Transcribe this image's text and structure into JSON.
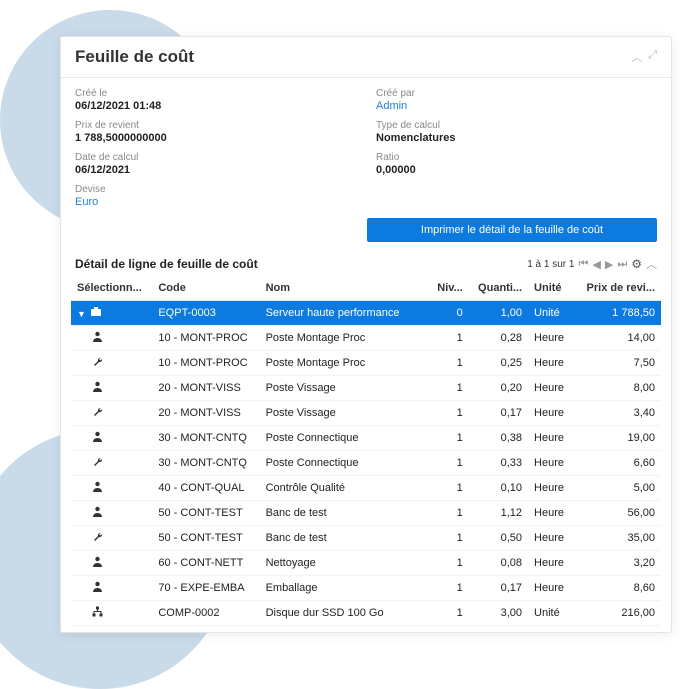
{
  "panel": {
    "title": "Feuille de coût"
  },
  "info": {
    "created_on_label": "Créé le",
    "created_on_value": "06/12/2021 01:48",
    "created_by_label": "Créé par",
    "created_by_value": "Admin",
    "cost_price_label": "Prix de revient",
    "cost_price_value": "1 788,5000000000",
    "calc_type_label": "Type de calcul",
    "calc_type_value": "Nomenclatures",
    "calc_date_label": "Date de calcul",
    "calc_date_value": "06/12/2021",
    "ratio_label": "Ratio",
    "ratio_value": "0,00000",
    "currency_label": "Devise",
    "currency_value": "Euro"
  },
  "buttons": {
    "print": "Imprimer le détail de la feuille de coût"
  },
  "detail": {
    "title": "Détail de ligne de feuille de coût",
    "pager_text": "1 à 1 sur 1",
    "columns": {
      "select": "Sélectionn...",
      "code": "Code",
      "name": "Nom",
      "level": "Niv...",
      "qty": "Quanti...",
      "unit": "Unité",
      "price": "Prix de revi..."
    },
    "rows": [
      {
        "icon": "product",
        "code": "EQPT-0003",
        "name": "Serveur haute performance",
        "level": "0",
        "qty": "1,00",
        "unit": "Unité",
        "price": "1 788,50",
        "selected": true
      },
      {
        "icon": "human",
        "code": "10 - MONT-PROC",
        "name": "Poste Montage Proc",
        "level": "1",
        "qty": "0,28",
        "unit": "Heure",
        "price": "14,00"
      },
      {
        "icon": "tool",
        "code": "10 - MONT-PROC",
        "name": "Poste Montage Proc",
        "level": "1",
        "qty": "0,25",
        "unit": "Heure",
        "price": "7,50"
      },
      {
        "icon": "human",
        "code": "20 - MONT-VISS",
        "name": "Poste Vissage",
        "level": "1",
        "qty": "0,20",
        "unit": "Heure",
        "price": "8,00"
      },
      {
        "icon": "tool",
        "code": "20 - MONT-VISS",
        "name": "Poste Vissage",
        "level": "1",
        "qty": "0,17",
        "unit": "Heure",
        "price": "3,40"
      },
      {
        "icon": "human",
        "code": "30 - MONT-CNTQ",
        "name": "Poste Connectique",
        "level": "1",
        "qty": "0,38",
        "unit": "Heure",
        "price": "19,00"
      },
      {
        "icon": "tool",
        "code": "30 - MONT-CNTQ",
        "name": "Poste Connectique",
        "level": "1",
        "qty": "0,33",
        "unit": "Heure",
        "price": "6,60"
      },
      {
        "icon": "human",
        "code": "40 - CONT-QUAL",
        "name": "Contrôle Qualité",
        "level": "1",
        "qty": "0,10",
        "unit": "Heure",
        "price": "5,00"
      },
      {
        "icon": "human",
        "code": "50 - CONT-TEST",
        "name": "Banc de test",
        "level": "1",
        "qty": "1,12",
        "unit": "Heure",
        "price": "56,00"
      },
      {
        "icon": "tool",
        "code": "50 - CONT-TEST",
        "name": "Banc de test",
        "level": "1",
        "qty": "0,50",
        "unit": "Heure",
        "price": "35,00"
      },
      {
        "icon": "human",
        "code": "60 - CONT-NETT",
        "name": "Nettoyage",
        "level": "1",
        "qty": "0,08",
        "unit": "Heure",
        "price": "3,20"
      },
      {
        "icon": "human",
        "code": "70 - EXPE-EMBA",
        "name": "Emballage",
        "level": "1",
        "qty": "0,17",
        "unit": "Heure",
        "price": "8,60"
      },
      {
        "icon": "tree",
        "code": "COMP-0002",
        "name": "Disque dur SSD 100 Go",
        "level": "1",
        "qty": "3,00",
        "unit": "Unité",
        "price": "216,00"
      }
    ]
  },
  "icons_map": {
    "product": "briefcase-icon",
    "human": "person-icon",
    "tool": "wrench-icon",
    "tree": "hierarchy-icon"
  }
}
